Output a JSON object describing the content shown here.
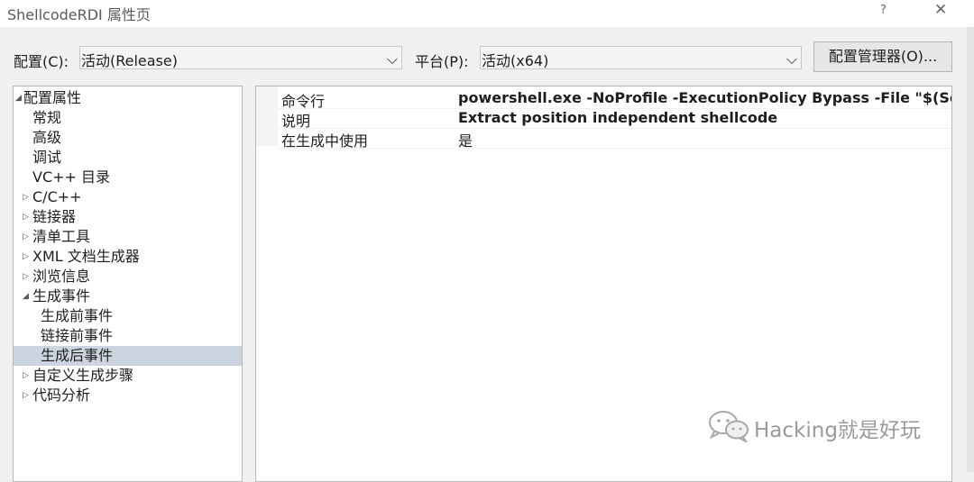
{
  "window": {
    "title": "ShellcodeRDI 属性页",
    "help_glyph": "?",
    "close_glyph": "✕"
  },
  "toolbar": {
    "config_label": "配置(C):",
    "config_value": "活动(Release)",
    "platform_label": "平台(P):",
    "platform_value": "活动(x64)",
    "config_manager_button": "配置管理器(O)...",
    "dropdown_glyph": "⌵"
  },
  "tree": {
    "items": [
      {
        "label": "配置属性",
        "expander": "◢",
        "expanded": true
      },
      {
        "label": "常规",
        "expander": ""
      },
      {
        "label": "高级",
        "expander": ""
      },
      {
        "label": "调试",
        "expander": ""
      },
      {
        "label": "VC++ 目录",
        "expander": ""
      },
      {
        "label": "C/C++",
        "expander": "▷",
        "expanded": false
      },
      {
        "label": "链接器",
        "expander": "▷",
        "expanded": false
      },
      {
        "label": "清单工具",
        "expander": "▷",
        "expanded": false
      },
      {
        "label": "XML 文档生成器",
        "expander": "▷",
        "expanded": false
      },
      {
        "label": "浏览信息",
        "expander": "▷",
        "expanded": false
      },
      {
        "label": "生成事件",
        "expander": "◢",
        "expanded": true
      },
      {
        "label": "生成前事件",
        "expander": ""
      },
      {
        "label": "链接前事件",
        "expander": ""
      },
      {
        "label": "生成后事件",
        "expander": "",
        "selected": true
      },
      {
        "label": "自定义生成步骤",
        "expander": "▷",
        "expanded": false
      },
      {
        "label": "代码分析",
        "expander": "▷",
        "expanded": false
      }
    ]
  },
  "properties": {
    "rows": [
      {
        "name": "命令行",
        "value": "powershell.exe -NoProfile -ExecutionPolicy Bypass -File \"$(Solutic"
      },
      {
        "name": "说明",
        "value": "Extract position independent shellcode"
      },
      {
        "name": "在生成中使用",
        "value": "是"
      }
    ]
  },
  "watermark": {
    "text": "Hacking就是好玩",
    "icon": "wechat-icon"
  },
  "colors": {
    "selection": "#ccd4e0",
    "window_bg": "#f0f0f0"
  }
}
